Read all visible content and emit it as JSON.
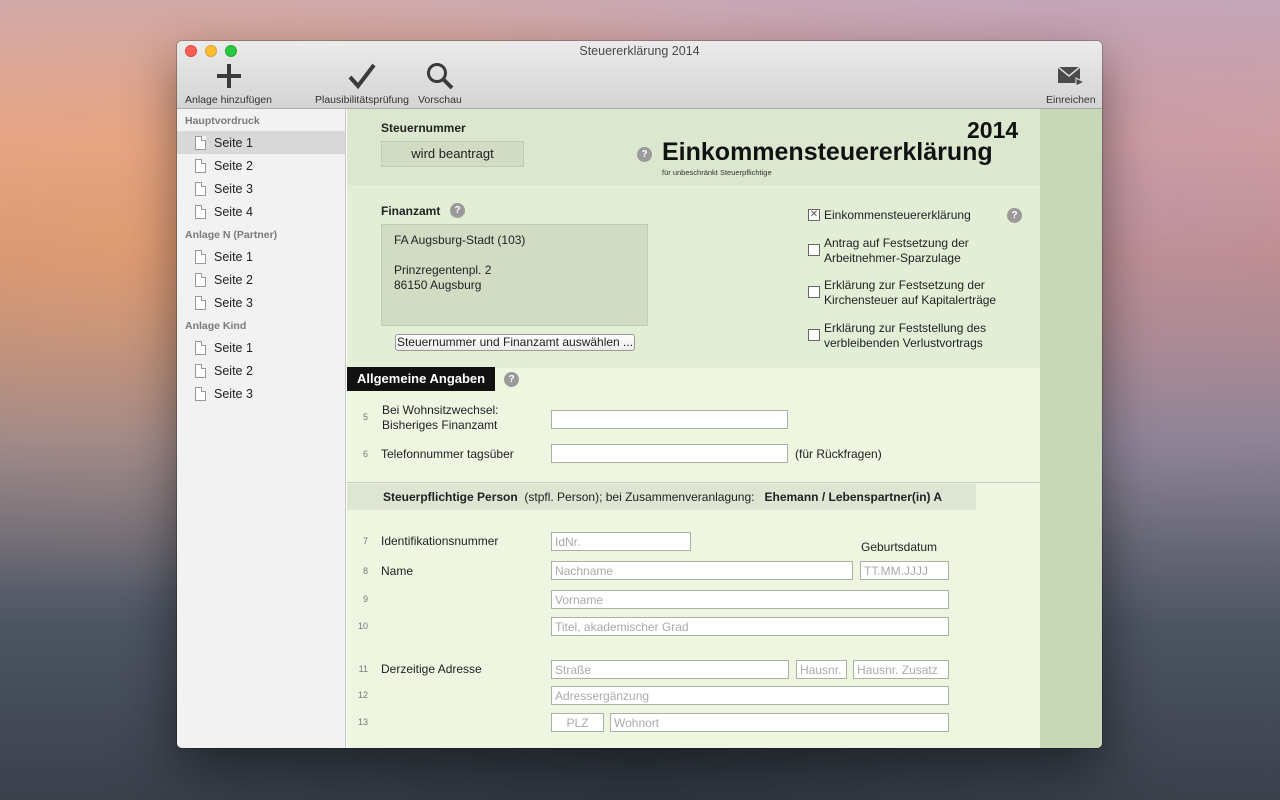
{
  "window": {
    "title": "Steuererklärung 2014"
  },
  "toolbar": {
    "add_label": "Anlage hinzufügen",
    "check_label": "Plausibilitätsprüfung",
    "preview_label": "Vorschau",
    "submit_label": "Einreichen"
  },
  "sidebar": {
    "groups": [
      {
        "title": "Hauptvordruck",
        "items": [
          "Seite 1",
          "Seite 2",
          "Seite 3",
          "Seite 4"
        ]
      },
      {
        "title": "Anlage N (Partner)",
        "items": [
          "Seite 1",
          "Seite 2",
          "Seite 3"
        ]
      },
      {
        "title": "Anlage Kind",
        "items": [
          "Seite 1",
          "Seite 2",
          "Seite 3"
        ]
      }
    ],
    "selected": "Hauptvordruck / Seite 1"
  },
  "header": {
    "steuernummer_label": "Steuernummer",
    "steuernummer_value": "wird beantragt",
    "year": "2014",
    "form_title": "Einkommensteuererklärung",
    "form_subtitle": "für unbeschränkt Steuerpflichtige",
    "help": "?"
  },
  "finanzamt": {
    "label": "Finanzamt",
    "name": "FA Augsburg-Stadt (103)",
    "street": "Prinzregentenpl. 2",
    "city": "86150 Augsburg",
    "select_button": "Steuernummer und Finanzamt auswählen ..."
  },
  "checkboxes": [
    {
      "line1": "Einkommensteuererklärung",
      "line2": "",
      "checked": true
    },
    {
      "line1": "Antrag auf Festsetzung der",
      "line2": "Arbeitnehmer-Sparzulage",
      "checked": false
    },
    {
      "line1": "Erklärung zur Festsetzung der",
      "line2": "Kirchensteuer auf Kapitalerträge",
      "checked": false
    },
    {
      "line1": "Erklärung zur Feststellung des",
      "line2": "verbleibenden Verlustvortrags",
      "checked": false
    }
  ],
  "allgemein": {
    "title": "Allgemeine Angaben",
    "rows": [
      {
        "num": "5",
        "label1": "Bei Wohnsitzwechsel:",
        "label2": "Bisheriges Finanzamt"
      },
      {
        "num": "6",
        "label1": "Telefonnummer tagsüber",
        "suffix": "(für Rückfragen)"
      }
    ]
  },
  "person": {
    "title_bold": "Steuerpflichtige Person",
    "title_mid": "(stpfl. Person); bei Zusammenveranlagung:",
    "title_end": "Ehemann / Lebenspartner(in) A",
    "geburtsdatum_label": "Geburtsdatum",
    "rows": {
      "r7": {
        "num": "7",
        "label": "Identifikationsnummer",
        "placeholder": "IdNr."
      },
      "r8": {
        "num": "8",
        "label": "Name",
        "placeholder": "Nachname",
        "date_placeholder": "TT.MM.JJJJ"
      },
      "r9": {
        "num": "9",
        "placeholder": "Vorname"
      },
      "r10": {
        "num": "10",
        "placeholder": "Titel, akademischer Grad"
      },
      "r11": {
        "num": "11",
        "label": "Derzeitige Adresse",
        "placeholder": "Straße",
        "nr": "Hausnr.",
        "zusatz": "Hausnr. Zusatz"
      },
      "r12": {
        "num": "12",
        "placeholder": "Adressergänzung"
      },
      "r13": {
        "num": "13",
        "plz": "PLZ",
        "ort": "Wohnort"
      }
    }
  }
}
